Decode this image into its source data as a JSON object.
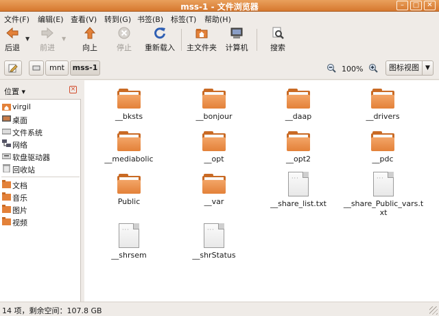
{
  "window": {
    "title": "mss-1 - 文件浏览器"
  },
  "menu": [
    "文件(F)",
    "编辑(E)",
    "查看(V)",
    "转到(G)",
    "书签(B)",
    "标签(T)",
    "帮助(H)"
  ],
  "toolbar": {
    "back": "后退",
    "forward": "前进",
    "up": "向上",
    "stop": "停止",
    "reload": "重新载入",
    "home": "主文件夹",
    "computer": "计算机",
    "search": "搜索"
  },
  "location": {
    "crumbs": [
      "mnt",
      "mss-1"
    ],
    "zoom": "100%",
    "view": "图标视图"
  },
  "sidebar": {
    "title": "位置",
    "places": [
      "virgil",
      "桌面",
      "文件系统",
      "网络",
      "软盘驱动器",
      "回收站"
    ],
    "bookmarks": [
      "文档",
      "音乐",
      "图片",
      "视频"
    ]
  },
  "files": [
    {
      "name": "__bksts",
      "type": "folder"
    },
    {
      "name": "__bonjour",
      "type": "folder"
    },
    {
      "name": "__daap",
      "type": "folder"
    },
    {
      "name": "__drivers",
      "type": "folder"
    },
    {
      "name": "__mediabolic",
      "type": "folder"
    },
    {
      "name": "__opt",
      "type": "folder"
    },
    {
      "name": "__opt2",
      "type": "folder"
    },
    {
      "name": "__pdc",
      "type": "folder"
    },
    {
      "name": "Public",
      "type": "folder"
    },
    {
      "name": "__var",
      "type": "folder"
    },
    {
      "name": "__share_list.txt",
      "type": "file"
    },
    {
      "name": "__share_Public_vars.txt",
      "type": "file"
    },
    {
      "name": "__shrsem",
      "type": "file"
    },
    {
      "name": "__shrStatus",
      "type": "file"
    }
  ],
  "status": "14 项，剩余空间：107.8 GB",
  "colors": {
    "titlebar": "#d6782f",
    "folder": "#e38139"
  }
}
